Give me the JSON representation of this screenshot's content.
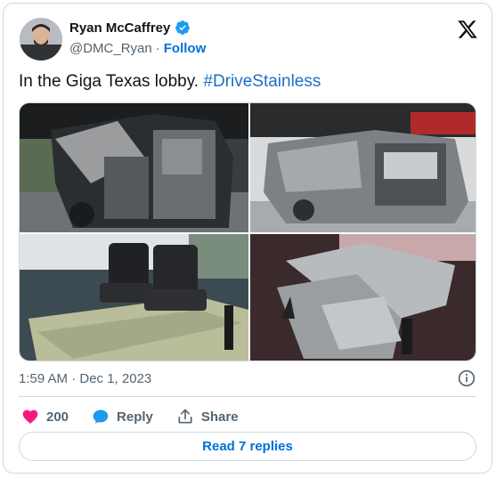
{
  "author": {
    "display_name": "Ryan McCaffrey",
    "handle": "@DMC_Ryan",
    "separator": "·",
    "follow_label": "Follow",
    "verified": true
  },
  "tweet": {
    "text": "In the Giga Texas lobby.",
    "hashtag": "#DriveStainless",
    "timestamp": "1:59 AM · Dec 1, 2023"
  },
  "media": {
    "count": 4
  },
  "actions": {
    "like_count": "200",
    "reply_label": "Reply",
    "share_label": "Share"
  },
  "read_replies_label": "Read 7 replies",
  "colors": {
    "accent_blue": "#006fd6",
    "like_pink": "#f91880",
    "verified_blue": "#1d9bf0",
    "text_secondary": "#536471",
    "border": "#cfd9de"
  },
  "icons": [
    "verified-badge-icon",
    "x-logo-icon",
    "info-icon",
    "heart-icon",
    "reply-icon",
    "share-icon"
  ]
}
